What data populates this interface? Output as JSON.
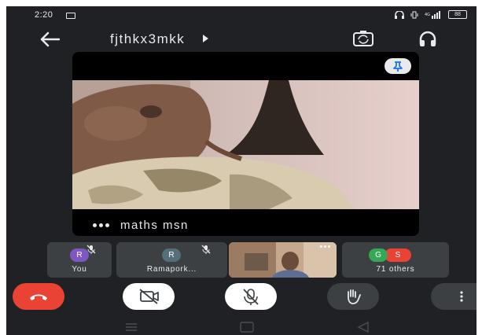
{
  "status_bar": {
    "time": "2:20",
    "right_text": "▯ ⦿ ᴸᵀᴱ",
    "battery": "88"
  },
  "meeting": {
    "title": "fjthkx3mkk"
  },
  "main_tile": {
    "participant_name": "maths msn"
  },
  "participants": [
    {
      "label": "You",
      "initial": "R",
      "avatar_color": "#7e57c2",
      "muted": true
    },
    {
      "label": "Ramapork...",
      "initial": "R",
      "avatar_color": "#546e7a",
      "muted": true
    },
    {
      "label": "",
      "initial": "",
      "avatar_color": "",
      "muted": false
    },
    {
      "label": "71 others",
      "initials": [
        "G",
        "S"
      ],
      "avatar_colors": [
        "#34a853",
        "#ea4335"
      ]
    }
  ],
  "controls": {
    "end_call_color": "#ea4335",
    "camera_off": true,
    "mic_off": true
  },
  "icons": {
    "back": "arrow-left-icon",
    "switch_camera": "switch-camera-icon",
    "audio_output": "headphones-icon",
    "pin": "pin-icon",
    "end_call": "phone-hangup-icon",
    "camera": "video-off-icon",
    "mic": "mic-off-icon",
    "raise_hand": "hand-icon",
    "more": "more-vert-icon"
  }
}
